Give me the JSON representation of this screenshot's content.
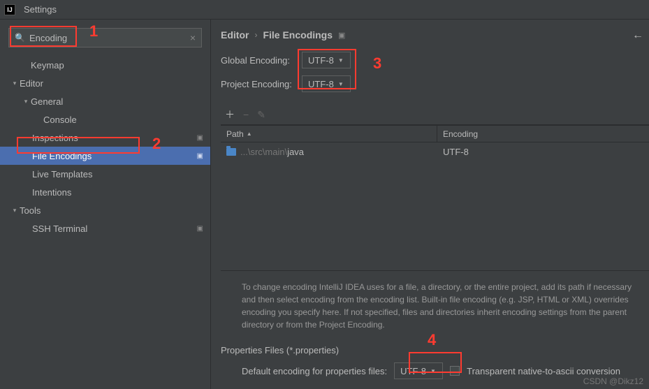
{
  "window": {
    "title": "Settings"
  },
  "search": {
    "value": "Encoding"
  },
  "tree": {
    "keymap": "Keymap",
    "editor": "Editor",
    "general": "General",
    "console": "Console",
    "inspections": "Inspections",
    "file_encodings": "File Encodings",
    "live_templates": "Live Templates",
    "intentions": "Intentions",
    "tools": "Tools",
    "ssh_terminal": "SSH Terminal"
  },
  "breadcrumb": {
    "a": "Editor",
    "b": "File Encodings"
  },
  "form": {
    "global_label": "Global Encoding:",
    "global_value": "UTF-8",
    "project_label": "Project Encoding:",
    "project_value": "UTF-8"
  },
  "table": {
    "col_path": "Path",
    "col_encoding": "Encoding",
    "rows": [
      {
        "path_dim": "...\\src\\main\\",
        "path_tail": "java",
        "encoding": "UTF-8"
      }
    ]
  },
  "help": "To change encoding IntelliJ IDEA uses for a file, a directory, or the entire project, add its path if necessary and then select encoding from the encoding list. Built-in file encoding (e.g. JSP, HTML or XML) overrides encoding you specify here. If not specified, files and directories inherit encoding settings from the parent directory or from the Project Encoding.",
  "props": {
    "section": "Properties Files (*.properties)",
    "default_label": "Default encoding for properties files:",
    "default_value": "UTF-8",
    "transparent": "Transparent native-to-ascii conversion"
  },
  "annotations": {
    "n1": "1",
    "n2": "2",
    "n3": "3",
    "n4": "4"
  },
  "watermark": "CSDN @Dikz12"
}
